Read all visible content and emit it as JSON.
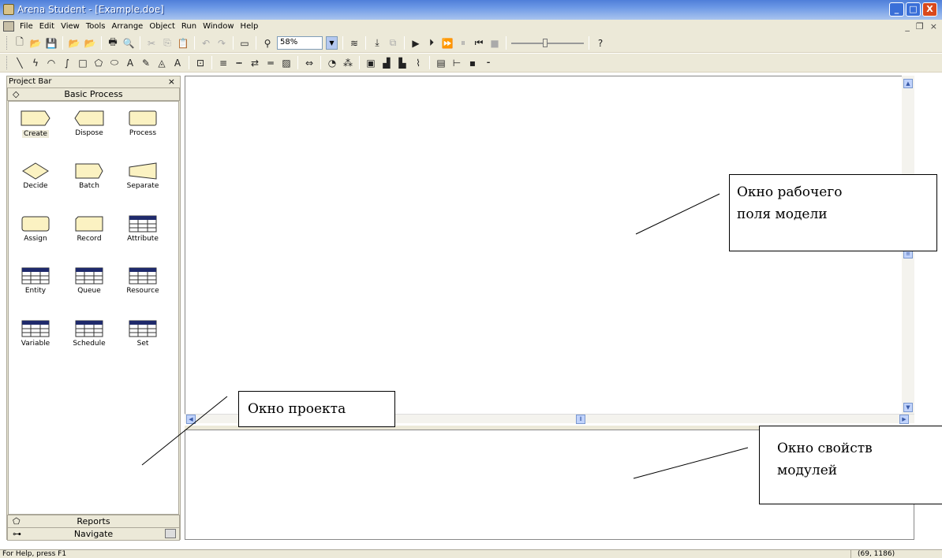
{
  "window": {
    "title": "Arena Student - [Example.doe]",
    "min": "_",
    "max": "□",
    "close": "X"
  },
  "menu": {
    "items": [
      "File",
      "Edit",
      "View",
      "Tools",
      "Arrange",
      "Object",
      "Run",
      "Window",
      "Help"
    ],
    "mdi_min": "_",
    "mdi_restore": "❐",
    "mdi_close": "×"
  },
  "toolbar": {
    "zoom": "58%"
  },
  "project_bar": {
    "title": "Project Bar",
    "close": "×",
    "panel_basic": "Basic Process",
    "panel_reports": "Reports",
    "panel_navigate": "Navigate",
    "modules": [
      {
        "label": "Create",
        "icon": "create-shape"
      },
      {
        "label": "Dispose",
        "icon": "dispose-shape"
      },
      {
        "label": "Process",
        "icon": "process-shape"
      },
      {
        "label": "Decide",
        "icon": "decide-shape"
      },
      {
        "label": "Batch",
        "icon": "batch-shape"
      },
      {
        "label": "Separate",
        "icon": "separate-shape"
      },
      {
        "label": "Assign",
        "icon": "assign-shape"
      },
      {
        "label": "Record",
        "icon": "record-shape"
      },
      {
        "label": "Attribute",
        "icon": "spreadsheet-icon"
      },
      {
        "label": "Entity",
        "icon": "spreadsheet-icon"
      },
      {
        "label": "Queue",
        "icon": "spreadsheet-icon"
      },
      {
        "label": "Resource",
        "icon": "spreadsheet-icon"
      },
      {
        "label": "Variable",
        "icon": "spreadsheet-icon"
      },
      {
        "label": "Schedule",
        "icon": "spreadsheet-icon"
      },
      {
        "label": "Set",
        "icon": "spreadsheet-icon"
      }
    ]
  },
  "callouts": {
    "model_window_line1": "Окно рабочего",
    "model_window_line2": "поля модели",
    "project_window": "Окно проекта",
    "props_window_line1": "Окно свойств",
    "props_window_line2": "модулей"
  },
  "status": {
    "help": "For Help, press F1",
    "coords": "(69, 1186)"
  },
  "colors": {
    "module_fill": "#fbf2c2",
    "table_header": "#1f2a6b",
    "chrome": "#ece9d8"
  }
}
